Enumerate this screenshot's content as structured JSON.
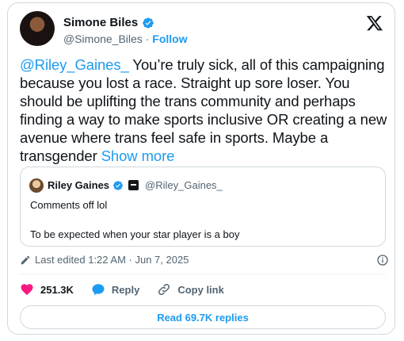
{
  "author": {
    "name": "Simone Biles",
    "handle": "@Simone_Biles",
    "separator": "·",
    "follow_label": "Follow"
  },
  "tweet": {
    "mention": "@Riley_Gaines_",
    "body": " You’re truly sick, all of this campaigning because you lost a race. Straight up sore loser. You should be uplifting the trans community and perhaps finding a way to make sports inclusive OR creating a new avenue where trans feel safe in sports. Maybe a transgender ",
    "show_more": "Show more"
  },
  "quote": {
    "name": "Riley Gaines",
    "handle": "@Riley_Gaines_",
    "line1": "Comments off lol",
    "line2": "To be expected when your star player is a boy"
  },
  "meta": {
    "edited": "Last edited 1:22 AM · Jun 7, 2025"
  },
  "actions": {
    "likes": "251.3K",
    "reply_label": "Reply",
    "copy_link_label": "Copy link"
  },
  "read_replies_label": "Read 69.7K replies",
  "colors": {
    "accent": "#1d9bf0",
    "like": "#f91880",
    "text": "#0f1419",
    "muted": "#536471",
    "border": "#cfd9de"
  },
  "icons": [
    "verified-badge-icon",
    "x-logo-icon",
    "affiliate-badge-icon",
    "pencil-icon",
    "info-icon",
    "heart-icon",
    "reply-bubble-icon",
    "link-icon"
  ]
}
